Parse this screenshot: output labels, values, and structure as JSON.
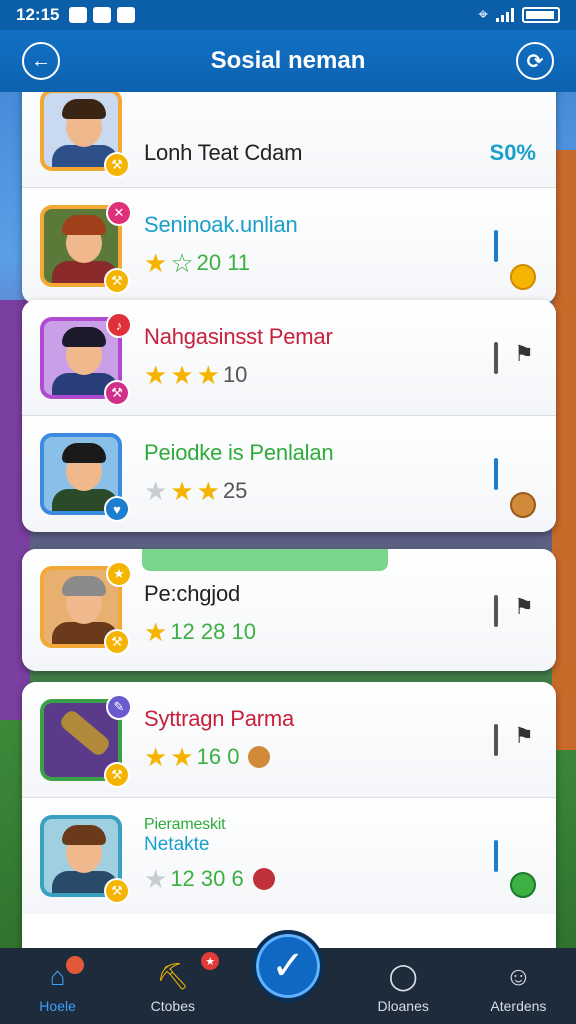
{
  "status": {
    "time": "12:15"
  },
  "app_bar": {
    "title": "Sosial neman"
  },
  "rows": [
    {
      "name": "Lonh Teat Cdam",
      "name_color": "#222222",
      "top_label": "percent",
      "percent": "S0%"
    },
    {
      "name": "Seninoak.unlian",
      "name_color": "#1aa0c8",
      "stars": [
        "gold",
        "green"
      ],
      "score": "20 11",
      "score_color": "#3cb043"
    },
    {
      "name": "Nahgasinsst Pemar",
      "name_color": "#c8203a",
      "stars": [
        "gold",
        "gold",
        "gold"
      ],
      "score": "10",
      "score_color": "#555555"
    },
    {
      "name": "Peiodke is Penlalan",
      "name_color": "#2eab3c",
      "stars": [
        "grey",
        "gold",
        "gold"
      ],
      "score": "25",
      "score_color": "#555555"
    },
    {
      "name": "Pe:chgjod",
      "name_color": "#222222",
      "stars": [
        "gold"
      ],
      "score": "12 28 10",
      "score_color": "#3cb043"
    },
    {
      "name": "Syttragn Parma",
      "name_color": "#c8203a",
      "stars": [
        "gold",
        "gold"
      ],
      "score": "16 0",
      "score_color": "#3cb043"
    },
    {
      "name": "Pierameskit",
      "name2": "Netakte",
      "name_color": "#2eab3c",
      "name2_color": "#1aa0c8",
      "stars": [
        "grey"
      ],
      "score": "12 30 6",
      "score_color": "#3cb043"
    }
  ],
  "nav": {
    "items": [
      {
        "label": "Hoele",
        "icon": "home-icon"
      },
      {
        "label": "Ctobes",
        "icon": "coins-icon"
      },
      {
        "label": "Dloanes",
        "icon": "chat-icon"
      },
      {
        "label": "Aterdens",
        "icon": "person-icon"
      }
    ],
    "center_icon": "check-icon"
  },
  "colors": {
    "primary": "#0d62b0",
    "gold": "#f4b400",
    "nav_bg": "#1e2b3a",
    "active": "#3aa0ff"
  }
}
